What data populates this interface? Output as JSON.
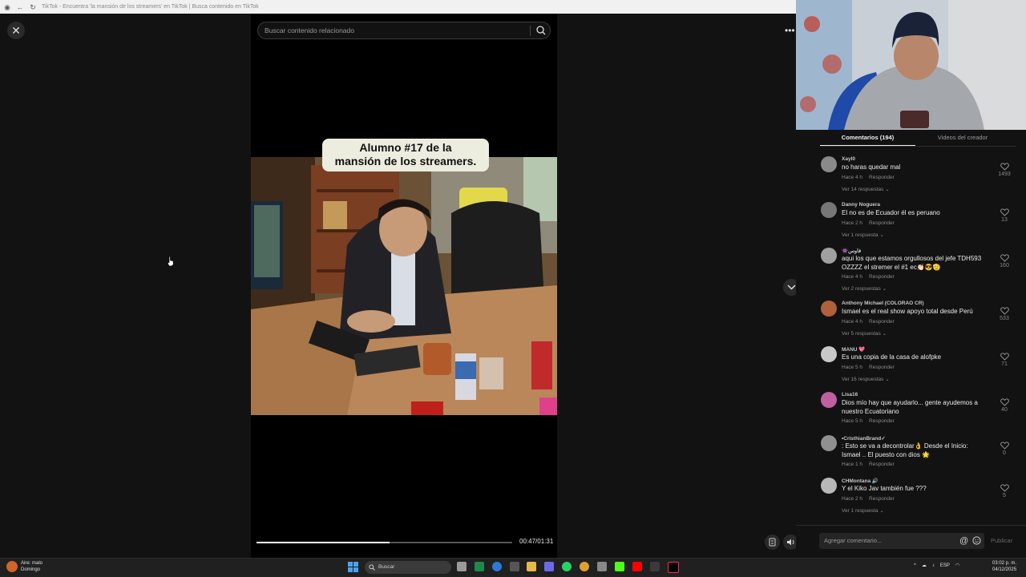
{
  "browser": {
    "tab_title": "TikTok - Encuentra 'la mansión de los streamers' en TikTok | Busca contenido en TikTok"
  },
  "search": {
    "placeholder": "Buscar contenido relacionado"
  },
  "video": {
    "caption_line1": "Alumno #17 de la",
    "caption_line2": "mansión de los streamers.",
    "time": "00:47/01:31",
    "progress": 0.52
  },
  "tabs": {
    "comments": "Comentarios (194)",
    "creator": "Videos del creador"
  },
  "comments": [
    {
      "user": "Xayl0",
      "text": "no haras quedar mal",
      "time": "Hace 4 h",
      "reply": "Responder",
      "likes": "1493",
      "replies": "Ver 14 respuestas",
      "avatar_color": "#8a8a8a"
    },
    {
      "user": "Danny Noguera",
      "text": "El no es de Ecuador él es peruano",
      "time": "Hace 2 h",
      "reply": "Responder",
      "likes": "13",
      "replies": "Ver 1 respuesta",
      "avatar_color": "#777777"
    },
    {
      "user": "👾فاوس",
      "text": "aqui los que estamos orgullosos del jefe TDH593 OZZZZ el stremer el #1 ec👏🏻😎🫡",
      "time": "Hace 4 h",
      "reply": "Responder",
      "likes": "160",
      "replies": "Ver 2 respuestas",
      "avatar_color": "#a0a0a0"
    },
    {
      "user": "Anthony Michael (COLORAO CR)",
      "text": "Ismael es el real show apoyo total desde Perú",
      "time": "Hace 4 h",
      "reply": "Responder",
      "likes": "533",
      "replies": "Ver 5 respuestas",
      "avatar_color": "#b0603a"
    },
    {
      "user": "MANU 💖",
      "text": "Es una copia de la casa de alofpke",
      "time": "Hace 5 h",
      "reply": "Responder",
      "likes": "71",
      "replies": "Ver 16 respuestas",
      "avatar_color": "#c8c8c8"
    },
    {
      "user": "Lisa16",
      "text": "Dios mío hay que ayudarlo... gente ayudemos a nuestro Ecuatoriano",
      "time": "Hace 5 h",
      "reply": "Responder",
      "likes": "40",
      "replies": "",
      "avatar_color": "#c060a0"
    },
    {
      "user": "•CristhianBrand✓",
      "text": ": Esto se va a decontrolar👌 Desde el Inicio: Ismael .. El puesto con dios 🌟",
      "time": "Hace 1 h",
      "reply": "Responder",
      "likes": "0",
      "replies": "",
      "avatar_color": "#909090"
    },
    {
      "user": "CHMontana 🔊",
      "text": "Y el Kiko Jav también fue ???",
      "time": "Hace 2 h",
      "reply": "Responder",
      "likes": "5",
      "replies": "Ver 1 respuesta",
      "avatar_color": "#b8b8b8"
    }
  ],
  "comment_input": {
    "placeholder": "Agregar comentario...",
    "publish": "Publicar"
  },
  "taskbar": {
    "weather_line1": "Aire: malo",
    "weather_line2": "Domingo",
    "search_placeholder": "Buscar",
    "lang": "ESP",
    "time": "03:02 p. m.",
    "date": "04/12/2025"
  },
  "colors": {
    "accent": "#fe2c55",
    "panel_bg": "#121212"
  }
}
